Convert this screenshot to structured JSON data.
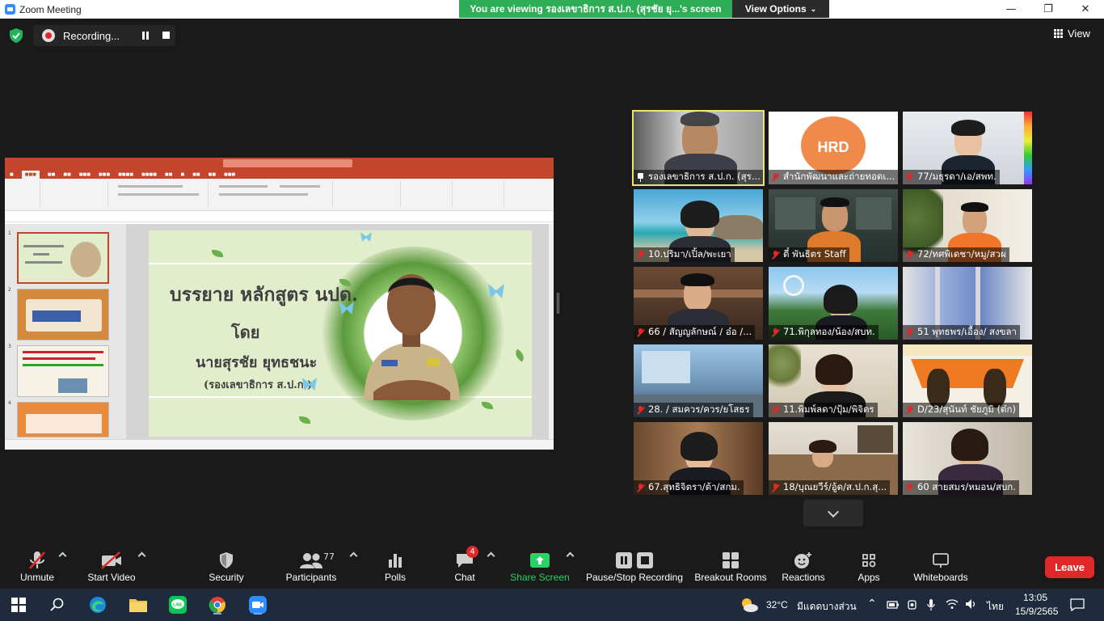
{
  "window": {
    "title": "Zoom Meeting"
  },
  "banner": {
    "text": "You are viewing รองเลขาธิการ ส.ป.ก. (สุรชัย ยุ...'s screen",
    "view_options": "View Options"
  },
  "recording": {
    "label": "Recording..."
  },
  "view": {
    "label": "View"
  },
  "shared_screen": {
    "slide_lines": [
      "บรรยาย หลักสูตร นปด.",
      "โดย",
      "นายสุรชัย  ยุทธชนะ",
      "(รองเลขาธิการ ส.ป.ก.)"
    ],
    "thumb_numbers": [
      "1",
      "2",
      "3",
      "4"
    ]
  },
  "participants": [
    {
      "name": "รองเลขาธิการ ส.ป.ก. (สุร...",
      "speaking": true,
      "icon": "pin-icon"
    },
    {
      "name": "สำนักพัฒนาและถ่ายทอดเ...",
      "icon": "mic-muted-icon"
    },
    {
      "name": "77/มธุรดา/เอ/สพท.",
      "icon": "mic-muted-icon"
    },
    {
      "name": "10.ปริมา/เปิ้ล/พะเยา",
      "icon": "mic-muted-icon"
    },
    {
      "name": "ตี๋ พันธิตร Staff",
      "icon": "mic-muted-icon"
    },
    {
      "name": "72/ทศพิเดชา/หมู/สวผ",
      "icon": "mic-muted-icon"
    },
    {
      "name": "66 / สัญญลักษณ์ / อ๋อ /...",
      "icon": "mic-muted-icon"
    },
    {
      "name": "71.พิกุลทอง/น้อง/สบท.",
      "icon": "mic-muted-icon"
    },
    {
      "name": "51 พุทธพร/เอื้อง/ สงขลา",
      "icon": "mic-muted-icon"
    },
    {
      "name": "28. / สมควร/ควร/ยโสธร",
      "icon": "mic-muted-icon"
    },
    {
      "name": "11.พิมพ์ลดา/ปุ้ม/พิจิตร",
      "icon": "mic-muted-icon"
    },
    {
      "name": "D/23/สุนันท์  ชัยภูมิ (ต๋ก)",
      "icon": "mic-muted-icon"
    },
    {
      "name": "67.สุทธิจิตรา/ต้า/สกม.",
      "icon": "mic-muted-icon"
    },
    {
      "name": "18/บุณยวีร์/อู้ด/ส.ป.ก.สุ...",
      "icon": "mic-muted-icon"
    },
    {
      "name": "60 สายสมร/หมอน/สบก.",
      "icon": "mic-muted-icon"
    }
  ],
  "tile_logo_text": "HRD",
  "toolbar": {
    "unmute": "Unmute",
    "start_video": "Start Video",
    "security": "Security",
    "participants": "Participants",
    "participants_count": "77",
    "polls": "Polls",
    "chat": "Chat",
    "chat_badge": "4",
    "share_screen": "Share Screen",
    "pause_recording": "Pause/Stop Recording",
    "breakout_rooms": "Breakout Rooms",
    "reactions": "Reactions",
    "apps": "Apps",
    "whiteboards": "Whiteboards",
    "leave": "Leave"
  },
  "taskbar": {
    "temperature": "32°C",
    "weather": "มีแดดบางส่วน",
    "language": "ไทย",
    "time": "13:05",
    "date": "15/9/2565"
  },
  "colors": {
    "accent_green": "#2dae56",
    "leave_red": "#e02828",
    "speaking_outline": "#e8e86a"
  }
}
